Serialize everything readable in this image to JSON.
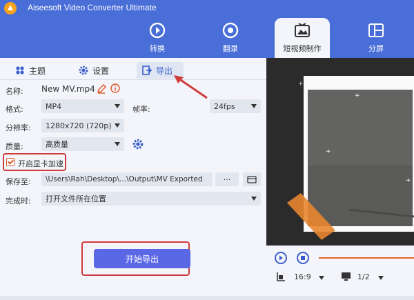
{
  "app": {
    "title": "Aiseesoft Video Converter Ultimate"
  },
  "nav": [
    {
      "label": "转换",
      "icon": "convert-icon"
    },
    {
      "label": "翻录",
      "icon": "ripper-icon"
    },
    {
      "label": "短视频制作",
      "icon": "mv-icon"
    },
    {
      "label": "分屏",
      "icon": "collage-icon"
    }
  ],
  "subtabs": {
    "theme": "主题",
    "settings": "设置",
    "export": "导出"
  },
  "form": {
    "name_label": "名称:",
    "name_value": "New MV.mp4",
    "format_label": "格式:",
    "format_value": "MP4",
    "fps_label": "帧率:",
    "fps_value": "24fps",
    "resolution_label": "分辨率:",
    "resolution_value": "1280x720 (720p)",
    "quality_label": "质量:",
    "quality_value": "高质量",
    "gpu_label": "开启显卡加速",
    "save_label": "保存至:",
    "save_path": "\\Users\\Rah\\Desktop\\...\\Output\\MV Exported",
    "browse": "···",
    "complete_label": "完成时:",
    "complete_value": "打开文件所在位置"
  },
  "export_button": "开始导出",
  "player": {
    "ratio": "16:9",
    "page": "1/2"
  },
  "colors": {
    "header": "#4a6ed8",
    "accent_button": "#5b68e6",
    "annotation": "#cf3b3b"
  }
}
